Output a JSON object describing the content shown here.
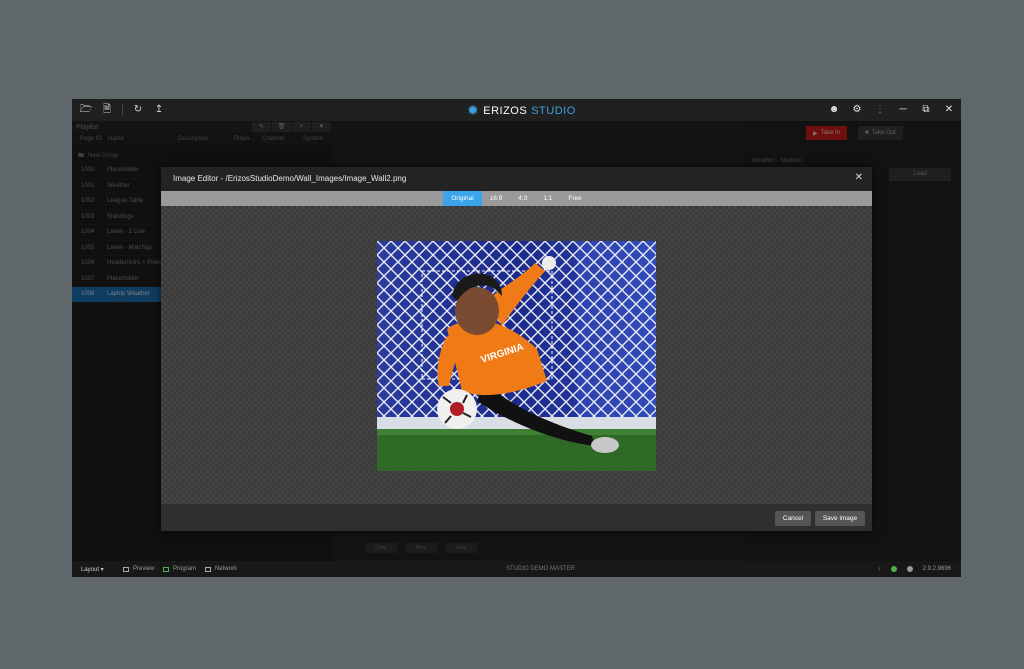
{
  "app": {
    "logo_primary": "ERIZOS",
    "logo_secondary": "STUDIO"
  },
  "playlist": {
    "title": "Playlist",
    "columns": [
      "Page ID",
      "Name",
      "Description",
      "Playo...",
      "Channel",
      "System"
    ],
    "group": "New Group",
    "pages": [
      {
        "id": "1000",
        "name": "Placeholder",
        "selected": false
      },
      {
        "id": "1001",
        "name": "Weather",
        "selected": false
      },
      {
        "id": "1002",
        "name": "League Table",
        "selected": false
      },
      {
        "id": "1003",
        "name": "Standings",
        "selected": false
      },
      {
        "id": "1004",
        "name": "Lower - 2 Line",
        "selected": false
      },
      {
        "id": "1005",
        "name": "Lower - Matchup",
        "selected": false
      },
      {
        "id": "1006",
        "name": "Header/Intro + Preview",
        "selected": false
      },
      {
        "id": "1007",
        "name": "Placeholder",
        "selected": false
      },
      {
        "id": "1008",
        "name": "Laptop Weather",
        "selected": true
      }
    ]
  },
  "right_panel": {
    "take_in": "Take In",
    "take_out": "Take Out",
    "label": "Weather - Stadium",
    "button": "Load"
  },
  "bottom_buttons": [
    "Clear",
    "Prev",
    "Save"
  ],
  "status": {
    "layout": "Layout ▾",
    "preview": "Preview",
    "program": "Program",
    "network": "Network",
    "center": "STUDIO DEMO MASTER",
    "version": "2.9.2.9696"
  },
  "image_editor": {
    "title": "Image Editor - /ErizosStudioDemo/Wall_Images/Image_Wall2.png",
    "ratios": [
      {
        "label": "Original",
        "active": true
      },
      {
        "label": "16:9",
        "active": false
      },
      {
        "label": "4:3",
        "active": false
      },
      {
        "label": "1:1",
        "active": false
      },
      {
        "label": "Free",
        "active": false
      }
    ],
    "jersey_text": "VIRGINIA",
    "cancel_label": "Cancel",
    "save_label": "Save image"
  },
  "colors": {
    "accent": "#3aa5ea",
    "take_in": "#c91e1e",
    "selected_row": "#1e6db0"
  }
}
